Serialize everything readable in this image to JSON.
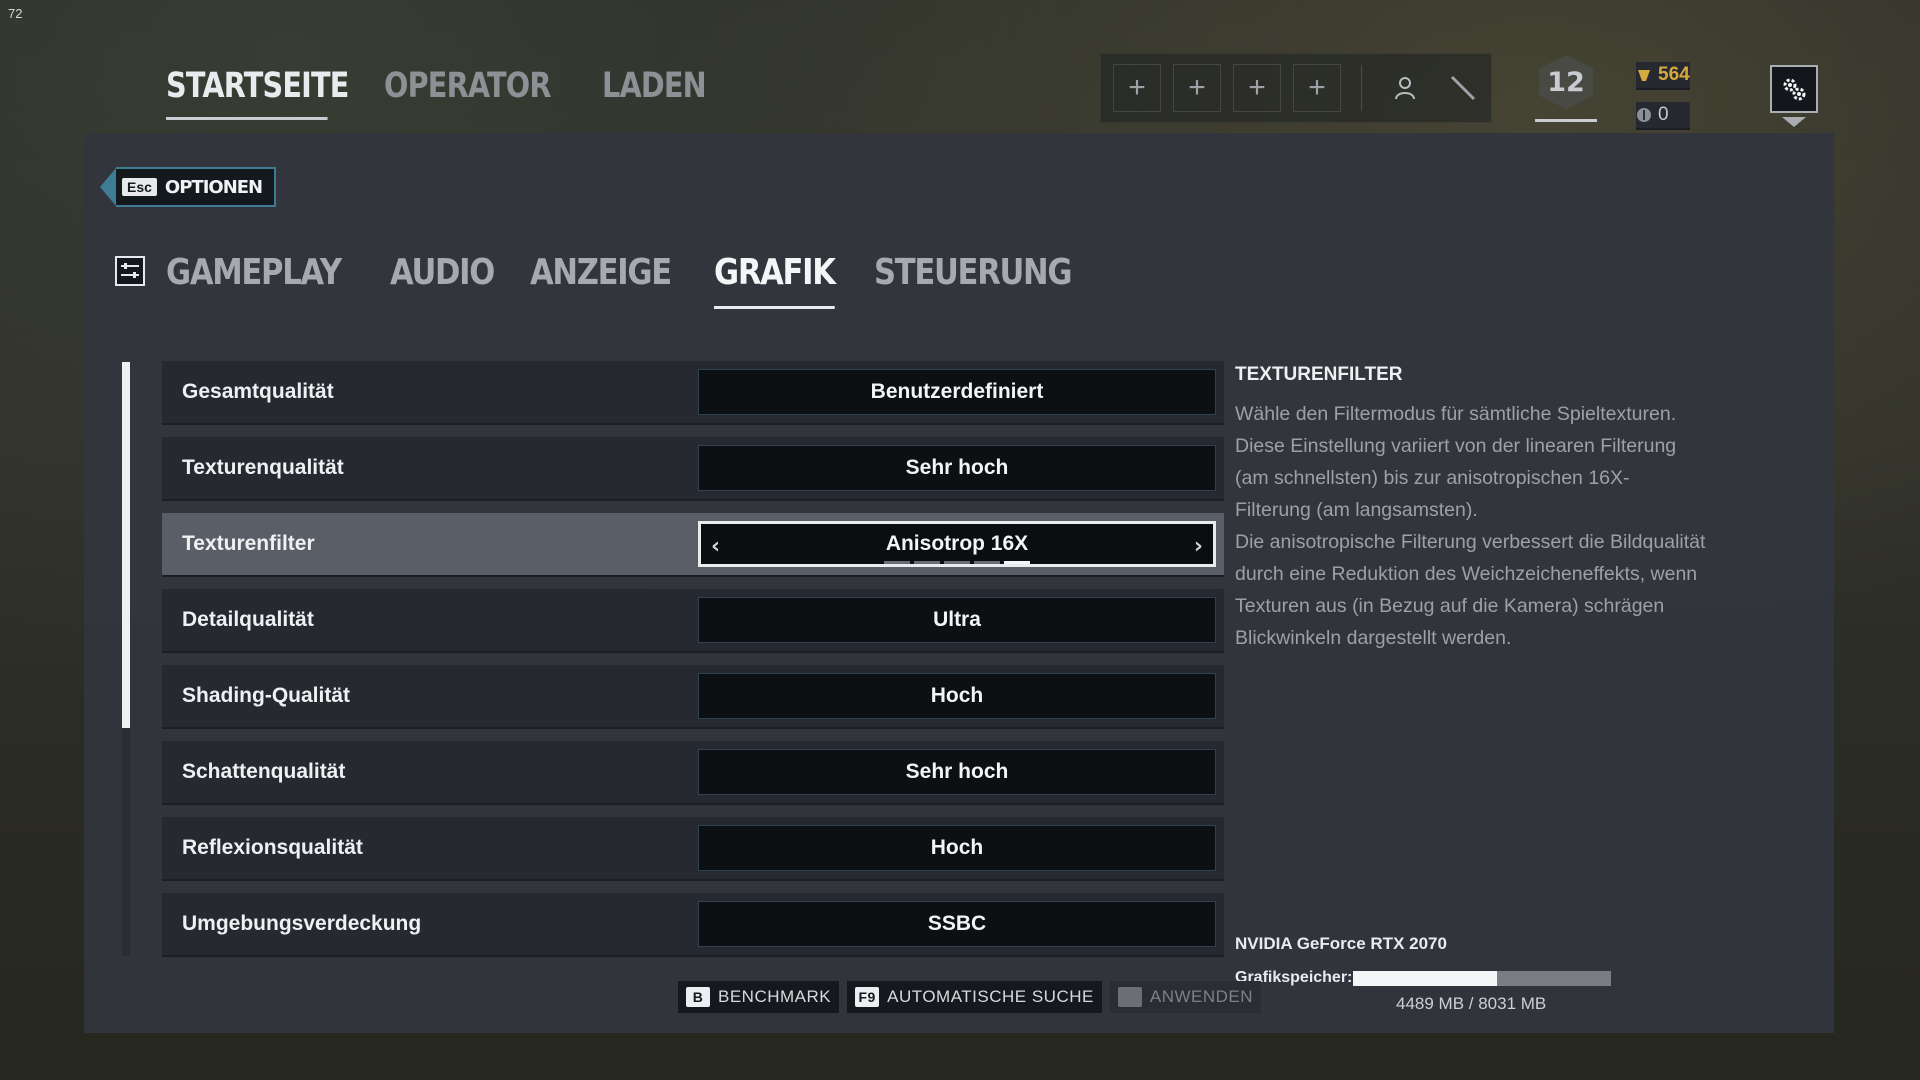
{
  "fps": "72",
  "topnav": [
    "STARTSEITE",
    "OPERATOR",
    "LADEN"
  ],
  "header": {
    "level": "12",
    "renown": "564",
    "credits": "0",
    "squad_slot_icons": [
      "plus-icon",
      "plus-icon",
      "plus-icon",
      "plus-icon"
    ]
  },
  "options": {
    "esc_key": "Esc",
    "title": "OPTIONEN"
  },
  "tabs": [
    "GAMEPLAY",
    "AUDIO",
    "ANZEIGE",
    "GRAFIK",
    "STEUERUNG"
  ],
  "active_tab": "GRAFIK",
  "settings": [
    {
      "label": "Gesamtqualität",
      "value": "Benutzerdefiniert"
    },
    {
      "label": "Texturenqualität",
      "value": "Sehr hoch"
    },
    {
      "label": "Texturenfilter",
      "value": "Anisotrop 16X",
      "selected": true
    },
    {
      "label": "Detailqualität",
      "value": "Ultra"
    },
    {
      "label": "Shading-Qualität",
      "value": "Hoch"
    },
    {
      "label": "Schattenqualität",
      "value": "Sehr hoch"
    },
    {
      "label": "Reflexionsqualität",
      "value": "Hoch"
    },
    {
      "label": "Umgebungsverdeckung",
      "value": "SSBC"
    }
  ],
  "texture_filter_option_index": 5,
  "texture_filter_option_count": 5,
  "description": {
    "title": "TEXTURENFILTER",
    "lines": [
      "Wähle den Filtermodus für sämtliche Spieltexturen.",
      "Diese Einstellung variiert von der linearen Filterung",
      "(am schnellsten) bis zur anisotropischen 16X-",
      "Filterung (am langsamsten).",
      "Die anisotropische Filterung verbessert die Bildqualität",
      "durch eine Reduktion des Weichzeicheneffekts, wenn",
      "Texturen aus (in Bezug auf die Kamera) schrägen",
      "Blickwinkeln dargestellt werden."
    ]
  },
  "gpu": {
    "name": "NVIDIA GeForce RTX 2070",
    "vram_label": "Grafikspeicher:",
    "vram_text": "4489 MB / 8031 MB",
    "vram_used_fraction": 0.559
  },
  "buttons": [
    {
      "key": "B",
      "label": "BENCHMARK",
      "disabled": false
    },
    {
      "key": "F9",
      "label": "AUTOMATISCHE SUCHE",
      "disabled": false
    },
    {
      "key": "",
      "label": "ANWENDEN",
      "disabled": true
    }
  ],
  "colors": {
    "accent": "#3e7c94",
    "gold": "#d6a93e",
    "panel": "#32353c"
  }
}
